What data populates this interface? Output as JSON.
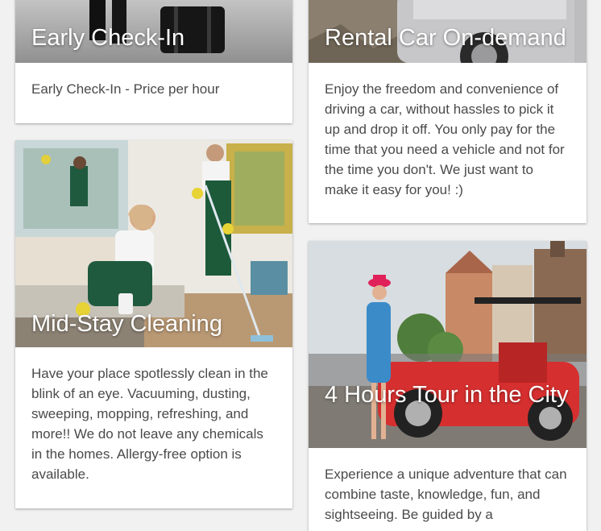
{
  "cards": [
    {
      "title": "Early Check-In",
      "description": "Early Check-In - Price per hour"
    },
    {
      "title": "Rental Car On-demand",
      "description": "Enjoy the freedom and convenience of driving a car, without hassles to pick it up and drop it off. You only pay for the time that you need a vehicle and not for the time you don't. We just want to make it easy for you! :)"
    },
    {
      "title": "Mid-Stay Cleaning",
      "description": "Have your place spotlessly clean in the blink of an eye. Vacuuming, dusting, sweeping, mopping, refreshing, and more!! We do not leave any chemicals in the homes. Allergy-free option is available."
    },
    {
      "title": "4 Hours Tour in the City",
      "description": "Experience a unique adventure that can combine taste, knowledge, fun, and sightseeing. Be guided by a"
    }
  ],
  "colors": {
    "background": "#f1f1f1",
    "card": "#ffffff",
    "body_text": "#4a4a4a",
    "title_text": "#ffffff"
  }
}
